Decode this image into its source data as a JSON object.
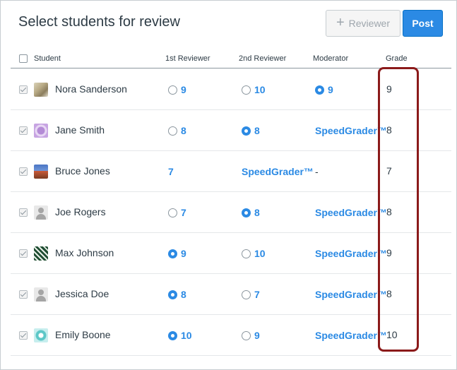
{
  "page": {
    "title": "Select students for review"
  },
  "toolbar": {
    "reviewer_label": "Reviewer",
    "post_label": "Post"
  },
  "table": {
    "headers": {
      "student": "Student",
      "first_reviewer": "1st Reviewer",
      "second_reviewer": "2nd Reviewer",
      "moderator": "Moderator",
      "grade": "Grade"
    },
    "rows": [
      {
        "name": "Nora Sanderson",
        "avatar": "photo-avatar",
        "r1": {
          "value": "9",
          "radio": "unselected"
        },
        "r2": {
          "value": "10",
          "radio": "unselected"
        },
        "mod": {
          "value": "9",
          "radio": "selected"
        },
        "grade": "9"
      },
      {
        "name": "Jane Smith",
        "avatar": "purple-pattern-avatar",
        "r1": {
          "value": "8",
          "radio": "unselected"
        },
        "r2": {
          "value": "8",
          "radio": "selected"
        },
        "mod": {
          "value": "SpeedGrader™",
          "radio": "none"
        },
        "grade": "8"
      },
      {
        "name": "Bruce Jones",
        "avatar": "landscape-avatar",
        "r1": {
          "value": "7",
          "radio": "none"
        },
        "r2": {
          "value": "SpeedGrader™",
          "radio": "none"
        },
        "mod": {
          "value": "-",
          "radio": "none"
        },
        "grade": "7"
      },
      {
        "name": "Joe Rogers",
        "avatar": "default-person-avatar",
        "r1": {
          "value": "7",
          "radio": "unselected"
        },
        "r2": {
          "value": "8",
          "radio": "selected"
        },
        "mod": {
          "value": "SpeedGrader™",
          "radio": "none"
        },
        "grade": "8"
      },
      {
        "name": "Max Johnson",
        "avatar": "green-pattern-avatar",
        "r1": {
          "value": "9",
          "radio": "selected"
        },
        "r2": {
          "value": "10",
          "radio": "unselected"
        },
        "mod": {
          "value": "SpeedGrader™",
          "radio": "none"
        },
        "grade": "9"
      },
      {
        "name": "Jessica Doe",
        "avatar": "default-person-avatar",
        "r1": {
          "value": "8",
          "radio": "selected"
        },
        "r2": {
          "value": "7",
          "radio": "unselected"
        },
        "mod": {
          "value": "SpeedGrader™",
          "radio": "none"
        },
        "grade": "8"
      },
      {
        "name": "Emily Boone",
        "avatar": "teal-pattern-avatar",
        "r1": {
          "value": "10",
          "radio": "selected"
        },
        "r2": {
          "value": "9",
          "radio": "unselected"
        },
        "mod": {
          "value": "SpeedGrader™",
          "radio": "none"
        },
        "grade": "10"
      }
    ]
  },
  "colors": {
    "link": "#2b8ae4",
    "post_button": "#2b8ae4",
    "highlight_border": "#8b1a1a"
  }
}
